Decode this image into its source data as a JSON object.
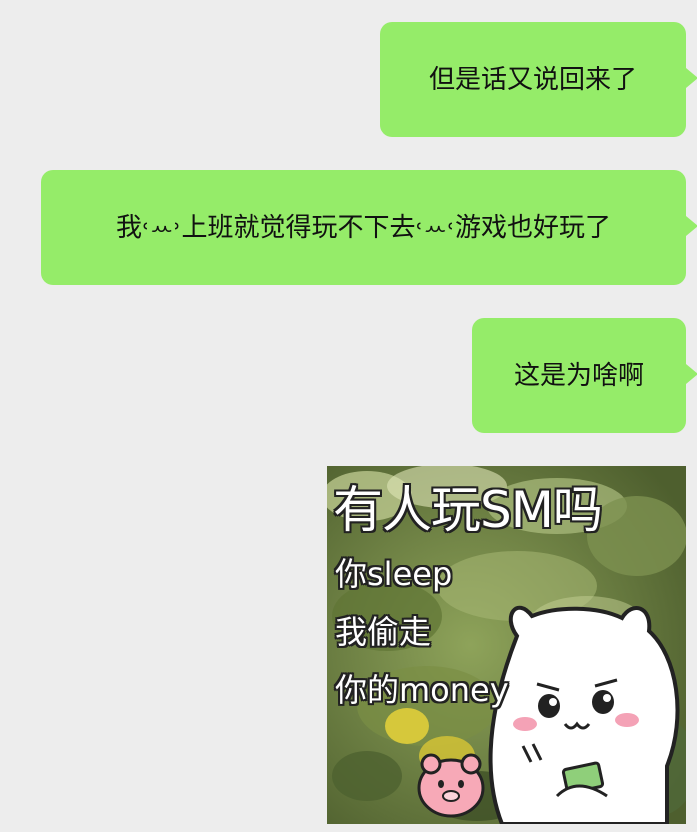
{
  "messages": [
    {
      "side": "right",
      "text": "但是话又说回来了"
    },
    {
      "side": "right",
      "text": "我˓ꕀ˒上班就觉得玩不下去˓ꕀ˓游戏也好玩了"
    },
    {
      "side": "right",
      "text": "这是为啥啊"
    }
  ],
  "sticker": {
    "title": "有人玩SM吗",
    "line1": "你sleep",
    "line2": "我偷走",
    "line3": "你的money"
  },
  "colors": {
    "background": "#ededed",
    "bubble": "#95ec69"
  }
}
